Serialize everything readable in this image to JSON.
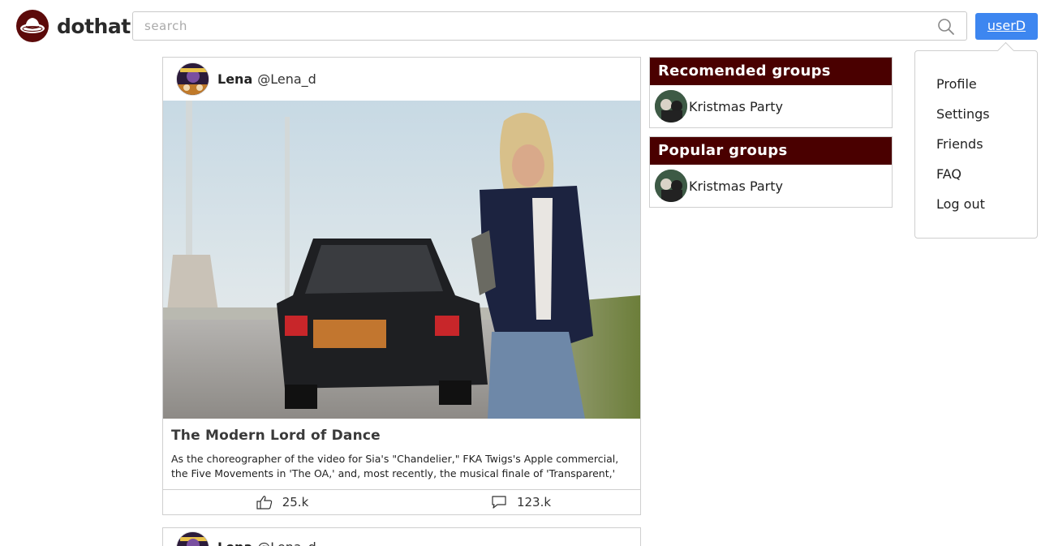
{
  "header": {
    "logo_text": "dothat",
    "search_placeholder": "search",
    "user_button": "userD"
  },
  "user_menu": {
    "items": [
      "Profile",
      "Settings",
      "Friends",
      "FAQ",
      "Log out"
    ]
  },
  "posts": [
    {
      "name": "Lena",
      "handle": "@Lena_d",
      "title": "The Modern Lord of Dance",
      "text": "As the choreographer of the video for Sia's \"Chandelier,\" FKA Twigs's Apple commercial, the Five Movements in 'The OA,' and, most recently, the musical finale of 'Transparent,' Ryan Heffington",
      "likes": "25.k",
      "comments": "123.k"
    },
    {
      "name": "Lena",
      "handle": "@Lena_d"
    }
  ],
  "sidebar": {
    "recommended_title": "Recomended groups",
    "recommended_groups": [
      "Kristmas Party"
    ],
    "popular_title": "Popular groups",
    "popular_groups": [
      "Kristmas Party"
    ]
  },
  "colors": {
    "brand": "#5c0a0a",
    "group_header": "#4a0000",
    "user_button": "#3d86f0"
  },
  "icons": [
    "logo-hat-icon",
    "search-icon",
    "thumbs-up-icon",
    "comment-icon"
  ]
}
